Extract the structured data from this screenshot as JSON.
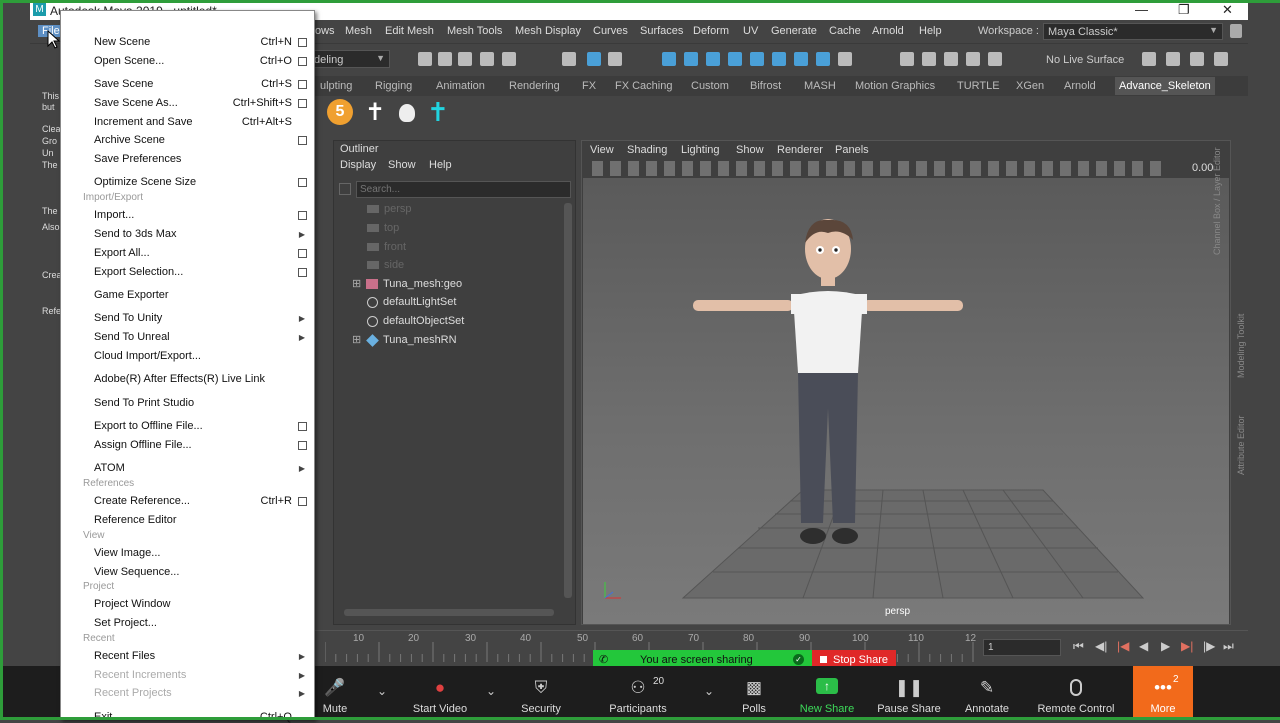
{
  "title": "Autodesk Maya 2019 - untitled*",
  "menubar": {
    "file_tab": "File",
    "items": [
      "ows",
      "Mesh",
      "Edit Mesh",
      "Mesh Tools",
      "Mesh Display",
      "Curves",
      "Surfaces",
      "Deform",
      "UV",
      "Generate",
      "Cache",
      "Arnold",
      "Help"
    ],
    "workspace_label": "Workspace :",
    "workspace_value": "Maya Classic*"
  },
  "toolbar": {
    "mode": "deling",
    "live_surface": "No Live Surface"
  },
  "shelf_tabs": [
    "ulpting",
    "Rigging",
    "Animation",
    "Rendering",
    "FX",
    "FX Caching",
    "Custom",
    "Bifrost",
    "MASH",
    "Motion Graphics",
    "TURTLE",
    "XGen",
    "Arnold",
    "Advance_Skeleton"
  ],
  "shelf_number": "5",
  "left_panel_text": [
    "This",
    "but",
    "Clea",
    "Gro",
    "Un",
    "The",
    "The",
    "Also",
    "Crea",
    "Refe"
  ],
  "outliner": {
    "title": "Outliner",
    "menu": [
      "Display",
      "Show",
      "Help"
    ],
    "search_placeholder": "Search...",
    "items": [
      {
        "label": "persp",
        "dim": true
      },
      {
        "label": "top",
        "dim": true
      },
      {
        "label": "front",
        "dim": true
      },
      {
        "label": "side",
        "dim": true
      },
      {
        "label": "Tuna_mesh:geo",
        "dim": false
      },
      {
        "label": "defaultLightSet",
        "dim": false
      },
      {
        "label": "defaultObjectSet",
        "dim": false
      },
      {
        "label": "Tuna_meshRN",
        "dim": false
      }
    ]
  },
  "viewport": {
    "menu": [
      "View",
      "Shading",
      "Lighting",
      "Show",
      "Renderer",
      "Panels"
    ],
    "value": "0.00",
    "camera_label": "persp",
    "side_labels": [
      "Channel Box / Layer Editor",
      "Modeling Toolkit",
      "Attribute Editor"
    ]
  },
  "timeline": {
    "ticks": [
      "10",
      "20",
      "30",
      "40",
      "50",
      "60",
      "70",
      "80",
      "90",
      "100",
      "110",
      "12"
    ],
    "frame": "1"
  },
  "screen_share": {
    "message": "You are screen sharing",
    "stop": "Stop Share"
  },
  "zoom": {
    "mute": "Mute",
    "start_video": "Start Video",
    "security": "Security",
    "participants": "Participants",
    "participants_count": "20",
    "polls": "Polls",
    "new_share": "New Share",
    "pause_share": "Pause Share",
    "annotate": "Annotate",
    "remote_control": "Remote Control",
    "more": "More",
    "more_badge": "2"
  },
  "file_menu": [
    {
      "type": "item",
      "label": "New Scene",
      "shortcut": "Ctrl+N",
      "box": true
    },
    {
      "type": "item",
      "label": "Open Scene...",
      "shortcut": "Ctrl+O",
      "box": true
    },
    {
      "type": "item",
      "label": "Save Scene",
      "shortcut": "Ctrl+S",
      "box": true
    },
    {
      "type": "item",
      "label": "Save Scene As...",
      "shortcut": "Ctrl+Shift+S",
      "box": true
    },
    {
      "type": "item",
      "label": "Increment and Save",
      "shortcut": "Ctrl+Alt+S",
      "box": false
    },
    {
      "type": "item",
      "label": "Archive Scene",
      "shortcut": "",
      "box": true
    },
    {
      "type": "item",
      "label": "Save Preferences",
      "shortcut": "",
      "box": false
    },
    {
      "type": "item",
      "label": "Optimize Scene Size",
      "shortcut": "",
      "box": true
    },
    {
      "type": "section",
      "label": "Import/Export"
    },
    {
      "type": "item",
      "label": "Import...",
      "shortcut": "",
      "box": true
    },
    {
      "type": "item",
      "label": "Send to 3ds Max",
      "shortcut": "",
      "arrow": true
    },
    {
      "type": "item",
      "label": "Export All...",
      "shortcut": "",
      "box": true
    },
    {
      "type": "item",
      "label": "Export Selection...",
      "shortcut": "",
      "box": true
    },
    {
      "type": "item",
      "label": "Game Exporter",
      "shortcut": ""
    },
    {
      "type": "item",
      "label": "Send To Unity",
      "shortcut": "",
      "arrow": true
    },
    {
      "type": "item",
      "label": "Send To Unreal",
      "shortcut": "",
      "arrow": true
    },
    {
      "type": "item",
      "label": "Cloud Import/Export...",
      "shortcut": ""
    },
    {
      "type": "item",
      "label": "Adobe(R) After Effects(R) Live Link",
      "shortcut": ""
    },
    {
      "type": "item",
      "label": "Send To Print Studio",
      "shortcut": ""
    },
    {
      "type": "item",
      "label": "Export to Offline File...",
      "shortcut": "",
      "box": true
    },
    {
      "type": "item",
      "label": "Assign Offline File...",
      "shortcut": "",
      "box": true
    },
    {
      "type": "item",
      "label": "ATOM",
      "shortcut": "",
      "arrow": true
    },
    {
      "type": "section",
      "label": "References"
    },
    {
      "type": "item",
      "label": "Create Reference...",
      "shortcut": "Ctrl+R",
      "box": true
    },
    {
      "type": "item",
      "label": "Reference Editor",
      "shortcut": ""
    },
    {
      "type": "section",
      "label": "View"
    },
    {
      "type": "item",
      "label": "View Image...",
      "shortcut": ""
    },
    {
      "type": "item",
      "label": "View Sequence...",
      "shortcut": ""
    },
    {
      "type": "section",
      "label": "Project"
    },
    {
      "type": "item",
      "label": "Project Window",
      "shortcut": ""
    },
    {
      "type": "item",
      "label": "Set Project...",
      "shortcut": ""
    },
    {
      "type": "section",
      "label": "Recent"
    },
    {
      "type": "item",
      "label": "Recent Files",
      "shortcut": "",
      "arrow": true
    },
    {
      "type": "item",
      "label": "Recent Increments",
      "shortcut": "",
      "arrow": true,
      "disabled": true
    },
    {
      "type": "item",
      "label": "Recent Projects",
      "shortcut": "",
      "arrow": true,
      "disabled": true
    },
    {
      "type": "item",
      "label": "Exit",
      "shortcut": "Ctrl+Q"
    }
  ]
}
